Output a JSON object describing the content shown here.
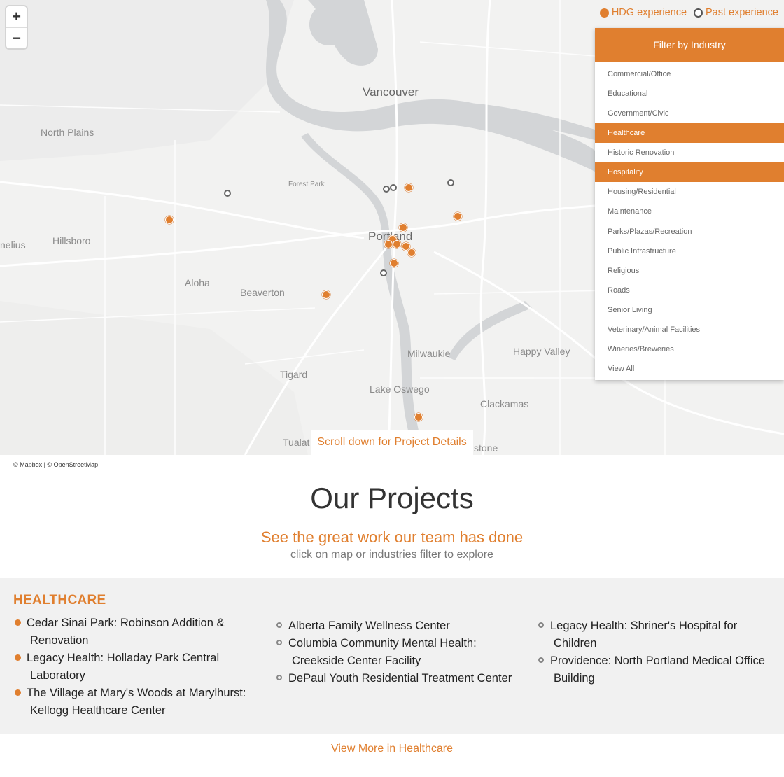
{
  "map": {
    "zoom_in": "+",
    "zoom_out": "−",
    "cities": {
      "vancouver": "Vancouver",
      "north_plains": "North Plains",
      "forest_park": "Forest Park",
      "portland": "Portland",
      "hillsboro": "Hillsboro",
      "cornelius": "nelius",
      "aloha": "Aloha",
      "beaverton": "Beaverton",
      "milwaukie": "Milwaukie",
      "happy_valley": "Happy Valley",
      "tigard": "Tigard",
      "lake_oswego": "Lake Oswego",
      "clackamas": "Clackamas",
      "tualatin": "Tualat",
      "gladstone": "stone"
    },
    "attribution": "© Mapbox | © OpenStreetMap",
    "scroll_hint": "Scroll down for Project Details"
  },
  "legend": {
    "hdg": "HDG experience",
    "past": "Past experience",
    "hdg_color": "#e07f2f"
  },
  "filter": {
    "title": "Filter by Industry",
    "items": [
      {
        "label": "Commercial/Office",
        "active": false
      },
      {
        "label": "Educational",
        "active": false
      },
      {
        "label": "Government/Civic",
        "active": false
      },
      {
        "label": "Healthcare",
        "active": true
      },
      {
        "label": "Historic Renovation",
        "active": false
      },
      {
        "label": "Hospitality",
        "active": true
      },
      {
        "label": "Housing/Residential",
        "active": false
      },
      {
        "label": "Maintenance",
        "active": false
      },
      {
        "label": "Parks/Plazas/Recreation",
        "active": false
      },
      {
        "label": "Public Infrastructure",
        "active": false
      },
      {
        "label": "Religious",
        "active": false
      },
      {
        "label": "Roads",
        "active": false
      },
      {
        "label": "Senior Living",
        "active": false
      },
      {
        "label": "Veterinary/Animal Facilities",
        "active": false
      },
      {
        "label": "Wineries/Breweries",
        "active": false
      },
      {
        "label": "View All",
        "active": false
      }
    ]
  },
  "section": {
    "title": "Our Projects",
    "subtitle": "See the great work our team has done",
    "hint": "click on map or industries filter to explore"
  },
  "projects": {
    "category": "HEALTHCARE",
    "col1": [
      {
        "l1": "Cedar Sinai Park: Robinson Addition &",
        "l2": "Renovation",
        "type": "hdg"
      },
      {
        "l1": "Legacy Health: Holladay Park Central",
        "l2": "Laboratory",
        "type": "hdg"
      },
      {
        "l1": "The Village at Mary's Woods at Marylhurst:",
        "l2": "Kellogg Healthcare Center",
        "type": "hdg"
      }
    ],
    "col2": [
      {
        "l1": "Alberta Family Wellness Center",
        "l2": "",
        "type": "past"
      },
      {
        "l1": "Columbia Community Mental Health:",
        "l2": "Creekside Center Facility",
        "type": "past"
      },
      {
        "l1": "DePaul Youth Residential Treatment Center",
        "l2": "",
        "type": "past"
      }
    ],
    "col3": [
      {
        "l1": "Legacy Health: Shriner's Hospital for",
        "l2": "Children",
        "type": "past"
      },
      {
        "l1": "Providence: North Portland Medical Office",
        "l2": "Building",
        "type": "past"
      }
    ],
    "view_more": "View More in Healthcare"
  }
}
